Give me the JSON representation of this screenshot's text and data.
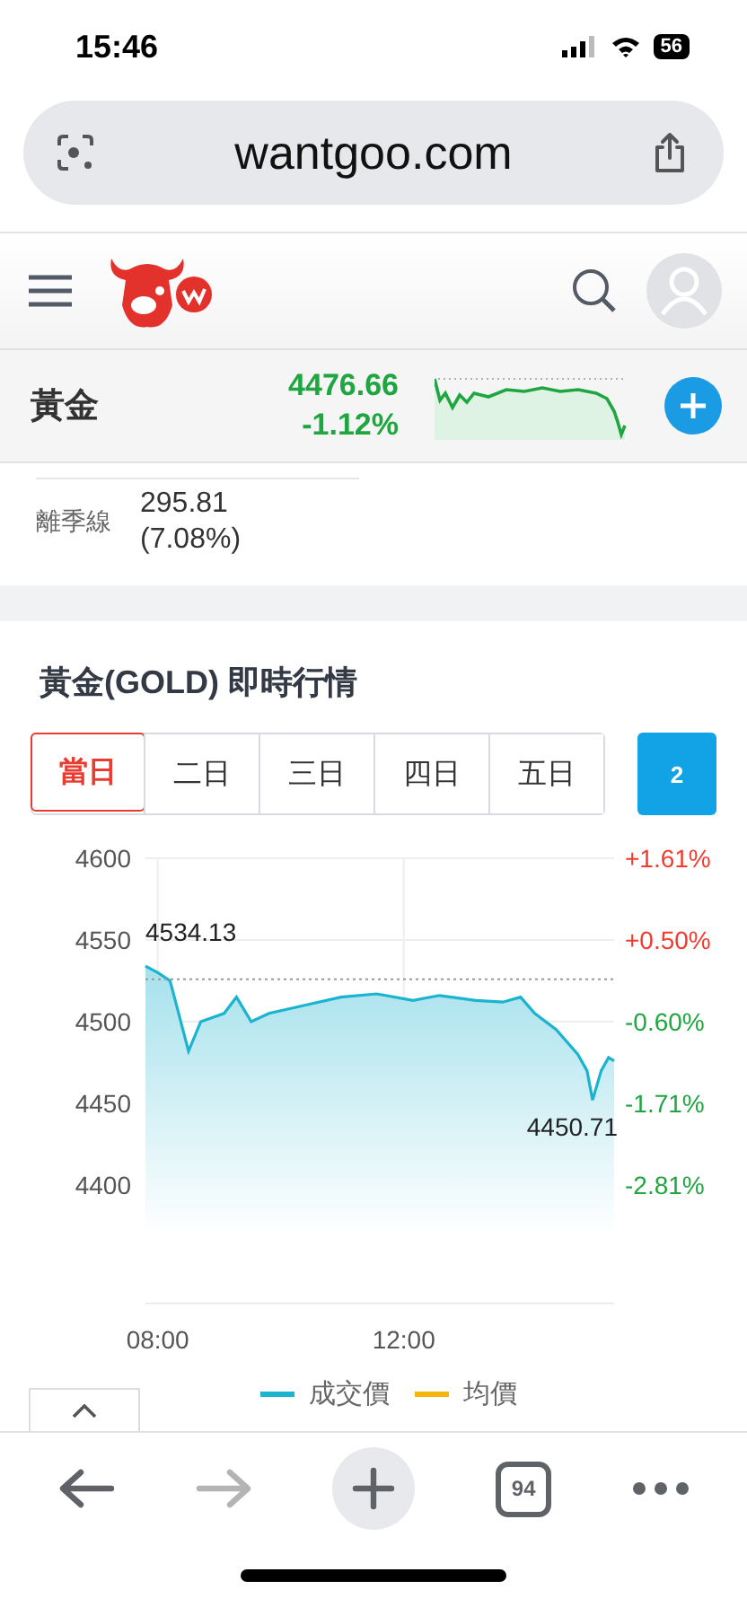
{
  "status_bar": {
    "time": "15:46",
    "battery": "56"
  },
  "browser": {
    "url": "wantgoo.com"
  },
  "quote": {
    "name": "黃金",
    "price": "4476.66",
    "change": "-1.12%",
    "color": "#1fa640"
  },
  "deviation": {
    "label": "離季線",
    "value": "295.81",
    "percent": "(7.08%)"
  },
  "section": {
    "title": "黃金(GOLD) 即時行情"
  },
  "range_tabs": [
    {
      "label": "當日",
      "selected": true
    },
    {
      "label": "二日",
      "selected": false
    },
    {
      "label": "三日",
      "selected": false
    },
    {
      "label": "四日",
      "selected": false
    },
    {
      "label": "五日",
      "selected": false
    }
  ],
  "extra_button": "2",
  "right_axis_labels": [
    {
      "text": "+1.61%",
      "color": "#f23b2f"
    },
    {
      "text": "+0.50%",
      "color": "#f23b2f"
    },
    {
      "text": "-0.60%",
      "color": "#1fa640"
    },
    {
      "text": "-1.71%",
      "color": "#1fa640"
    },
    {
      "text": "-2.81%",
      "color": "#1fa640"
    }
  ],
  "chart_data": {
    "type": "area",
    "x": [
      7.8,
      8.0,
      8.2,
      8.5,
      8.7,
      9.08,
      9.28,
      9.52,
      9.81,
      10.39,
      10.98,
      11.56,
      12.15,
      12.58,
      13.17,
      13.61,
      13.9,
      14.13,
      14.48,
      14.83,
      14.98,
      15.07,
      15.21,
      15.33,
      15.42
    ],
    "series": [
      {
        "name": "成交價",
        "color": "#1ab3d0",
        "values": [
          4534,
          4530,
          4525,
          4482,
          4500,
          4505,
          4515,
          4500,
          4505,
          4510,
          4515,
          4517,
          4513,
          4516,
          4513,
          4512,
          4515,
          4505,
          4495,
          4480,
          4470,
          4452,
          4470,
          4478,
          4476
        ]
      },
      {
        "name": "均價",
        "color": "#f5b50a",
        "values": [
          null,
          null,
          null,
          null,
          null,
          null,
          null,
          null,
          null,
          null,
          null,
          null,
          null,
          null,
          null,
          null,
          null,
          null,
          null,
          null,
          null,
          null,
          null,
          null,
          null
        ]
      }
    ],
    "xlim": [
      7.8,
      15.42
    ],
    "ylim": [
      4328,
      4600
    ],
    "xticks": [
      {
        "value": 8,
        "label": "08:00"
      },
      {
        "value": 12,
        "label": "12:00"
      }
    ],
    "yticks": [
      4400,
      4450,
      4500,
      4550,
      4600
    ],
    "grid": true,
    "ref_lines": [
      {
        "axis": "y",
        "value": 4526
      }
    ],
    "annotations": [
      "4534.13",
      "4450.71"
    ]
  },
  "toolbar": [
    {
      "kind": "back",
      "disabled": false
    },
    {
      "kind": "forward",
      "disabled": true
    },
    {
      "kind": "new-tab",
      "disabled": false
    },
    {
      "kind": "tabs",
      "label": "94",
      "disabled": false
    },
    {
      "kind": "more",
      "disabled": false
    }
  ]
}
